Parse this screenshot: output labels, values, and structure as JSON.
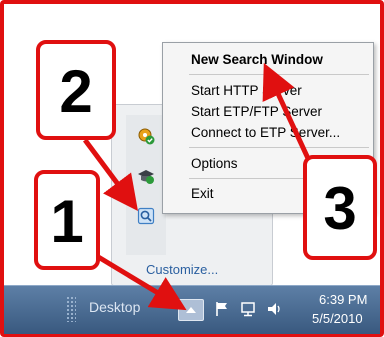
{
  "context_menu": {
    "items": [
      {
        "label": "New Search Window",
        "bold": true
      },
      {
        "label": "Start HTTP Server"
      },
      {
        "label": "Start ETP/FTP Server"
      },
      {
        "label": "Connect to ETP Server..."
      },
      {
        "label": "Options"
      },
      {
        "label": "Exit"
      }
    ]
  },
  "tray_popup": {
    "icons": [
      "gear-shield-icon",
      "mortarboard-icon",
      "search-app-icon"
    ],
    "customize_label": "Customize..."
  },
  "taskbar": {
    "desktop_label": "Desktop",
    "clock_time": "6:39 PM",
    "clock_date": "5/5/2010",
    "tray_icons": [
      "show-hidden-arrow-icon",
      "flag-icon",
      "network-icon",
      "speaker-icon"
    ]
  },
  "callouts": {
    "one": "1",
    "two": "2",
    "three": "3"
  },
  "colors": {
    "callout_red": "#e01010",
    "taskbar_top": "#5d7fa6",
    "taskbar_bottom": "#39597f",
    "menu_bg": "#f5f5f5"
  }
}
